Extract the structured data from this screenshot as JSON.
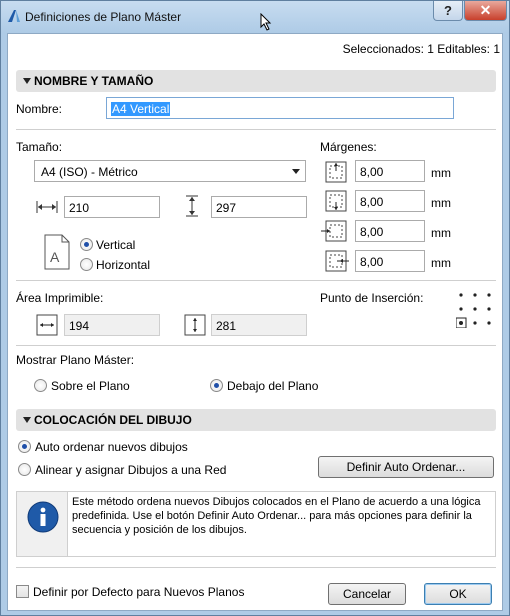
{
  "window": {
    "title": "Definiciones de Plano Máster",
    "help_label": "?",
    "close_label": "✕"
  },
  "header": {
    "selection_status": "Seleccionados: 1 Editables: 1"
  },
  "name_section": {
    "title": "NOMBRE Y TAMAÑO",
    "name_label": "Nombre:",
    "name_value": "A4 Vertical"
  },
  "size": {
    "label": "Tamaño:",
    "format_value": "A4 (ISO) - Métrico",
    "width_value": "210",
    "height_value": "297",
    "orientation_options": [
      "Vertical",
      "Horizontal"
    ],
    "orientation_selected": "Vertical",
    "page_icon_letter": "A"
  },
  "margins": {
    "label": "Márgenes:",
    "values": [
      "8,00",
      "8,00",
      "8,00",
      "8,00"
    ],
    "unit": "mm"
  },
  "printable_area": {
    "label": "Área Imprimible:",
    "width_value": "194",
    "height_value": "281"
  },
  "insertion_point": {
    "label": "Punto de Inserción:"
  },
  "show_master": {
    "label": "Mostrar Plano Máster:",
    "options": [
      "Sobre el Plano",
      "Debajo del Plano"
    ],
    "selected": "Debajo del Plano"
  },
  "placement_section": {
    "title": "COLOCACIÓN DEL DIBUJO",
    "options": [
      "Auto ordenar nuevos dibujos",
      "Alinear y asignar Dibujos a una Red"
    ],
    "selected": "Auto ordenar nuevos dibujos",
    "define_button": "Definir Auto Ordenar...",
    "info_text": "Este método ordena nuevos Dibujos colocados en el Plano de acuerdo a una lógica predefinida. Use el botón Definir Auto Ordenar... para más opciones para definir la secuencia y posición de los dibujos."
  },
  "footer": {
    "default_checkbox_label": "Definir por Defecto para Nuevos Planos",
    "cancel_label": "Cancelar",
    "ok_label": "OK"
  },
  "colors": {
    "title_bar": "#aecbe6",
    "close_button": "#c8402c",
    "selection_highlight": "#3399ff",
    "info_icon": "#1f5aa8"
  }
}
